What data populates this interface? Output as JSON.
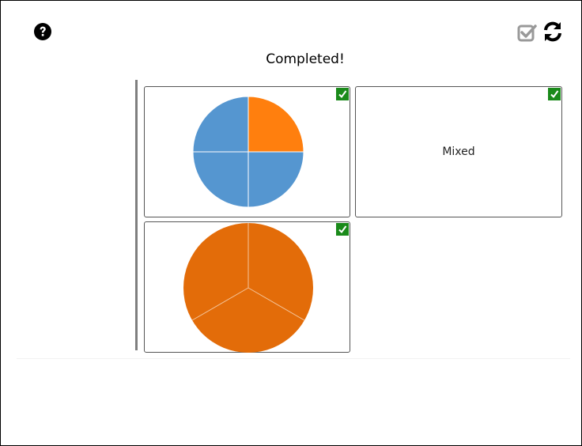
{
  "header": {
    "status": "Completed!",
    "help_icon": "question-circle-icon",
    "check_icon": "checkbox-check-icon",
    "reset_icon": "refresh-icon"
  },
  "cards": [
    {
      "kind": "pie",
      "slices_total": 4,
      "slices_highlighted": 1,
      "highlight_color": "#ff7f0e",
      "base_color": "#5596d0",
      "checked": true
    },
    {
      "kind": "text",
      "label": "Mixed",
      "checked": true
    },
    {
      "kind": "pie",
      "slices_total": 3,
      "slices_highlighted": 3,
      "highlight_color": "#e36c09",
      "base_color": "#e36c09",
      "checked": true
    }
  ],
  "colors": {
    "check_badge": "#1a8a1a",
    "divider": "#7f7f7f"
  }
}
